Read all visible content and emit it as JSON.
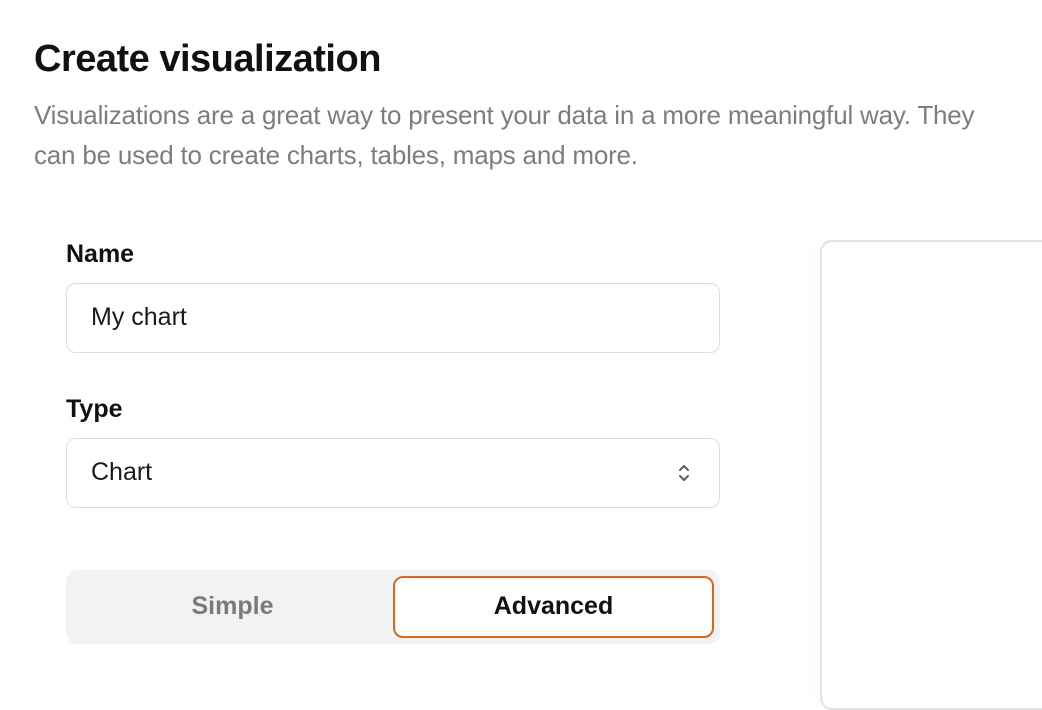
{
  "header": {
    "title": "Create visualization",
    "description": "Visualizations are a great way to present your data in a more meaningful way. They can be used to create charts, tables, maps and more."
  },
  "form": {
    "name": {
      "label": "Name",
      "value": "My chart"
    },
    "type": {
      "label": "Type",
      "value": "Chart"
    }
  },
  "tabs": {
    "simple": "Simple",
    "advanced": "Advanced",
    "active": "advanced"
  }
}
